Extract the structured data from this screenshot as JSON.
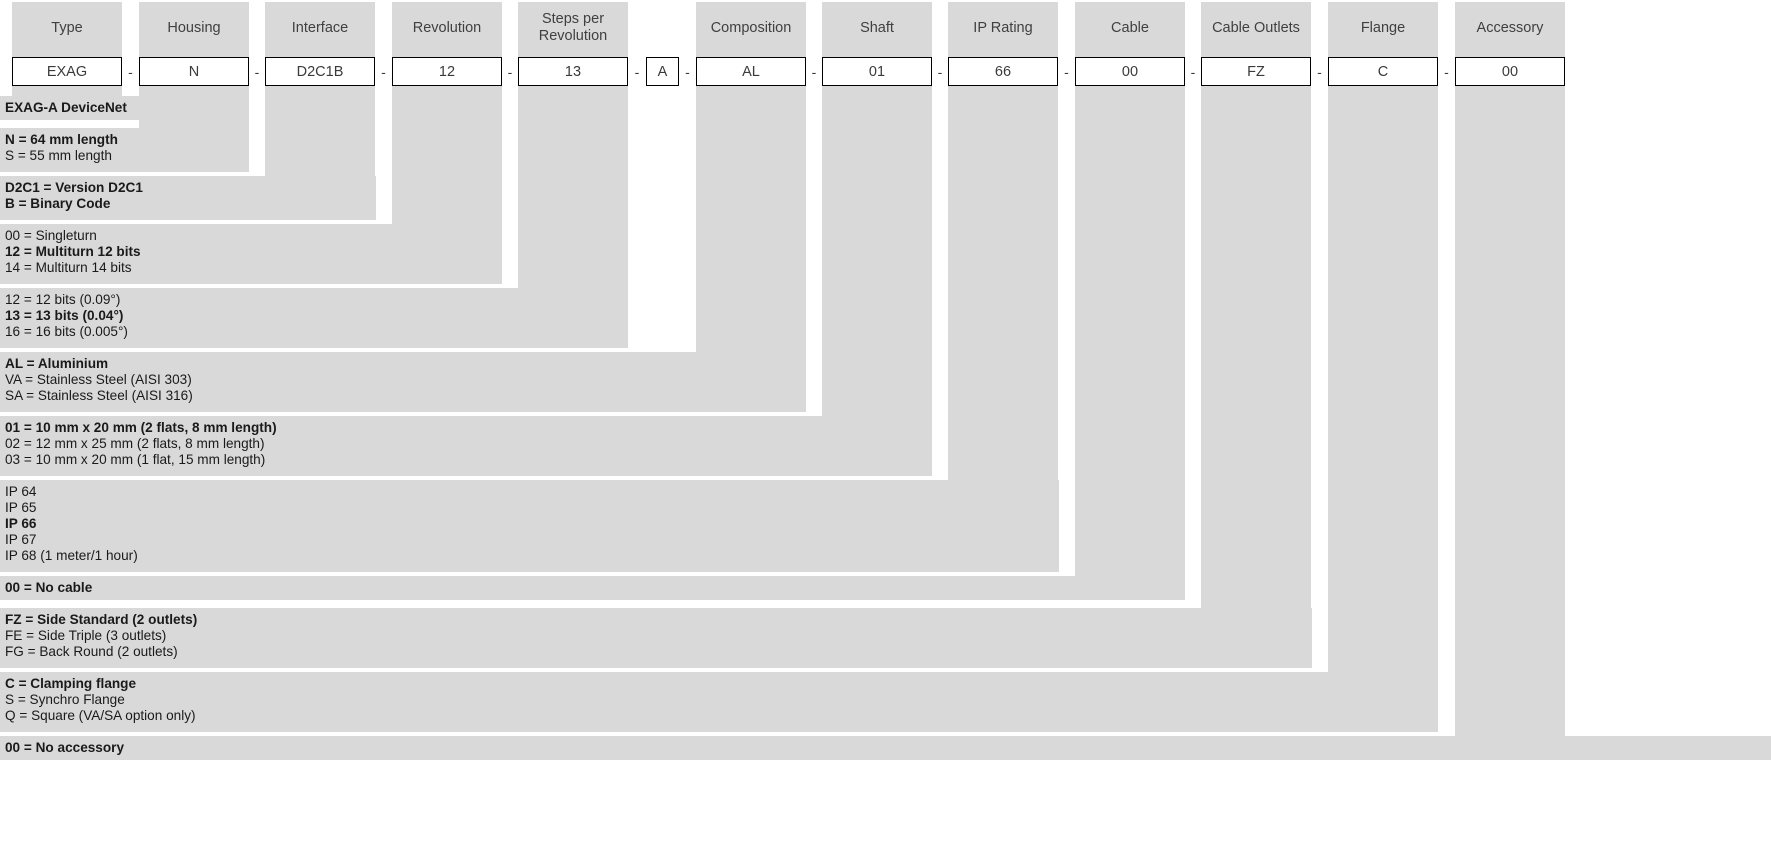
{
  "order_code": {
    "columns": [
      {
        "header": "Type",
        "value": "EXAG",
        "separator_after": ""
      },
      {
        "header": "Housing",
        "value": "N",
        "separator_after": "-"
      },
      {
        "header": "Interface",
        "value": "D2C1B",
        "separator_after": "-"
      },
      {
        "header": "Revolution",
        "value": "12",
        "separator_after": "-"
      },
      {
        "header": "Steps per Revolution",
        "value": "13",
        "separator_after": "-"
      },
      {
        "header": "",
        "value": "A",
        "separator_after": "-"
      },
      {
        "header": "Composition",
        "value": "AL",
        "separator_after": "-"
      },
      {
        "header": "Shaft",
        "value": "01",
        "separator_after": "-"
      },
      {
        "header": "IP Rating",
        "value": "66",
        "separator_after": "-"
      },
      {
        "header": "Cable",
        "value": "00",
        "separator_after": "-"
      },
      {
        "header": "Cable Outlets",
        "value": "FZ",
        "separator_after": "-"
      },
      {
        "header": "Flange",
        "value": "C",
        "separator_after": "-"
      },
      {
        "header": "Accessory",
        "value": "00",
        "separator_after": "-"
      }
    ],
    "legend_blocks": [
      {
        "name": "type",
        "lines": [
          {
            "text": "EXAG-A DeviceNet",
            "bold": true
          }
        ]
      },
      {
        "name": "housing",
        "lines": [
          {
            "text": "N = 64 mm length",
            "bold": true
          },
          {
            "text": "S = 55 mm length",
            "bold": false
          }
        ]
      },
      {
        "name": "interface",
        "lines": [
          {
            "text": "D2C1 = Version D2C1",
            "bold": true
          },
          {
            "text": "B = Binary Code",
            "bold": true
          }
        ]
      },
      {
        "name": "revolution",
        "lines": [
          {
            "text": "00 = Singleturn",
            "bold": false
          },
          {
            "text": "12 = Multiturn 12 bits",
            "bold": true
          },
          {
            "text": "14 = Multiturn 14 bits",
            "bold": false
          }
        ]
      },
      {
        "name": "steps-per-revolution",
        "lines": [
          {
            "text": "12 = 12 bits (0.09°)",
            "bold": false
          },
          {
            "text": "13 = 13 bits (0.04°)",
            "bold": true
          },
          {
            "text": "16 = 16 bits (0.005°)",
            "bold": false
          }
        ]
      },
      {
        "name": "composition",
        "lines": [
          {
            "text": "AL = Aluminium",
            "bold": true
          },
          {
            "text": "VA = Stainless Steel (AISI 303)",
            "bold": false
          },
          {
            "text": "SA = Stainless Steel (AISI 316)",
            "bold": false
          }
        ]
      },
      {
        "name": "shaft",
        "lines": [
          {
            "text": "01 = 10 mm x 20 mm (2 flats, 8 mm length)",
            "bold": true
          },
          {
            "text": "02 = 12 mm x 25 mm (2 flats, 8 mm length)",
            "bold": false
          },
          {
            "text": "03 = 10 mm x 20 mm (1 flat, 15 mm length)",
            "bold": false
          }
        ]
      },
      {
        "name": "ip-rating",
        "lines": [
          {
            "text": "IP 64",
            "bold": false
          },
          {
            "text": "IP 65",
            "bold": false
          },
          {
            "text": "IP 66",
            "bold": true
          },
          {
            "text": "IP 67",
            "bold": false
          },
          {
            "text": "IP 68 (1 meter/1 hour)",
            "bold": false
          }
        ]
      },
      {
        "name": "cable",
        "lines": [
          {
            "text": "00 = No cable",
            "bold": true
          }
        ]
      },
      {
        "name": "cable-outlets",
        "lines": [
          {
            "text": "FZ = Side Standard (2 outlets)",
            "bold": true
          },
          {
            "text": "FE = Side Triple (3 outlets)",
            "bold": false
          },
          {
            "text": "FG = Back Round (2 outlets)",
            "bold": false
          }
        ]
      },
      {
        "name": "flange",
        "lines": [
          {
            "text": "C = Clamping flange",
            "bold": true
          },
          {
            "text": "S = Synchro Flange",
            "bold": false
          },
          {
            "text": "Q = Square (VA/SA option only)",
            "bold": false
          }
        ]
      },
      {
        "name": "accessory",
        "lines": [
          {
            "text": "00 = No accessory",
            "bold": true
          }
        ]
      }
    ],
    "colors": {
      "panel_gray": "#d9d9d9",
      "background": "#ffffff",
      "header_text": "#404040",
      "box_border": "#000000",
      "body_text": "#1a1a1a"
    }
  }
}
